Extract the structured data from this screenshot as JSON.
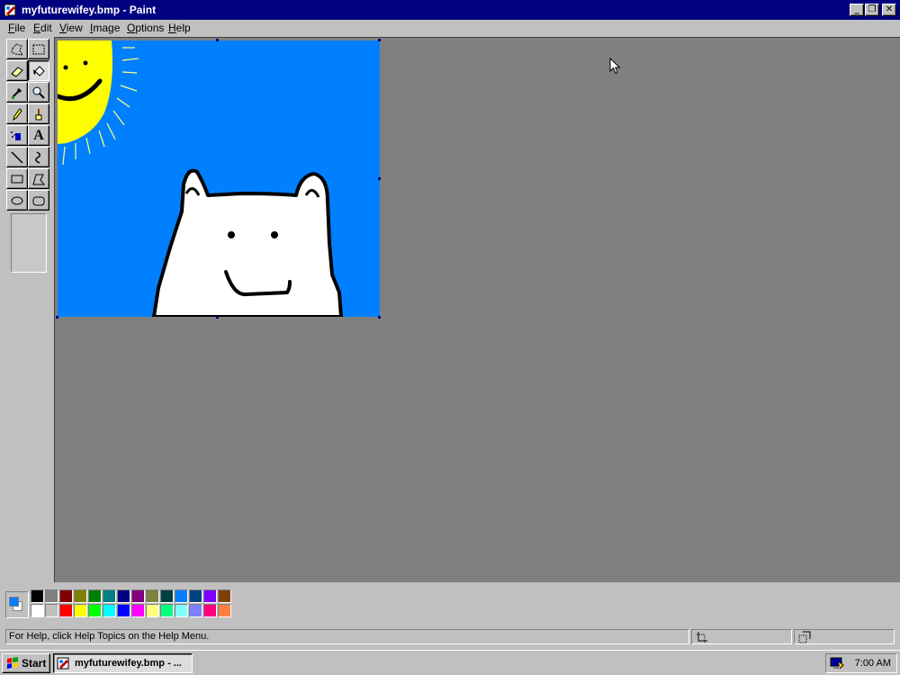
{
  "window": {
    "title": "myfuturewifey.bmp - Paint",
    "controls": {
      "minimize": "_",
      "restore": "❐",
      "close": "✕"
    }
  },
  "menu": {
    "items": [
      {
        "key": "F",
        "rest": "ile"
      },
      {
        "key": "E",
        "rest": "dit"
      },
      {
        "key": "V",
        "rest": "iew"
      },
      {
        "key": "I",
        "rest": "mage"
      },
      {
        "key": "O",
        "rest": "ptions"
      },
      {
        "key": "H",
        "rest": "elp"
      }
    ]
  },
  "toolbox": {
    "tools": [
      "free-form-select",
      "select",
      "eraser",
      "fill-with-color",
      "pick-color",
      "magnifier",
      "pencil",
      "brush",
      "airbrush",
      "text",
      "line",
      "curve",
      "rectangle",
      "polygon",
      "ellipse",
      "rounded-rectangle"
    ],
    "selected_tool": "fill-with-color",
    "text_tool_glyph": "A"
  },
  "canvas": {
    "image_name": "myfuturewifey.bmp",
    "background_color": "#0080ff",
    "sun_color": "#ffff00",
    "bear_color": "#ffffff"
  },
  "colors": {
    "foreground": "#0080ff",
    "background": "#ffffff",
    "palette_top": [
      "#000000",
      "#808080",
      "#800000",
      "#808000",
      "#008000",
      "#008080",
      "#000080",
      "#800080",
      "#808040",
      "#004040",
      "#0080ff",
      "#004080",
      "#8000ff",
      "#804000"
    ],
    "palette_bottom": [
      "#ffffff",
      "#c0c0c0",
      "#ff0000",
      "#ffff00",
      "#00ff00",
      "#00ffff",
      "#0000ff",
      "#ff00ff",
      "#ffff80",
      "#00ff80",
      "#80ffff",
      "#8080ff",
      "#ff0080",
      "#ff8040"
    ]
  },
  "status": {
    "help_text": "For Help, click Help Topics on the Help Menu.",
    "position": "",
    "size": ""
  },
  "taskbar": {
    "start_label": "Start",
    "task_label": "myfuturewifey.bmp - ...",
    "clock": "7:00 AM"
  }
}
